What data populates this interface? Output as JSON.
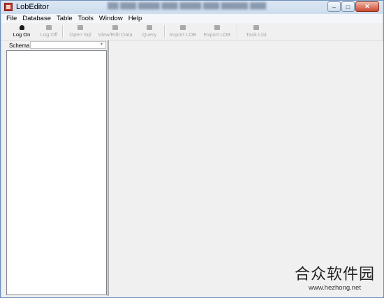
{
  "window": {
    "title": "LobEditor",
    "blurred_title_text": "(blurred text)"
  },
  "window_buttons": {
    "minimize": "–",
    "maximize": "□",
    "close": "✕"
  },
  "menu": [
    "File",
    "Database",
    "Table",
    "Tools",
    "Window",
    "Help"
  ],
  "toolbar": {
    "buttons": [
      {
        "label": "Log On",
        "enabled": true,
        "icon": "user-key-icon"
      },
      {
        "label": "Log Off",
        "enabled": false,
        "icon": "user-exit-icon"
      },
      {
        "label": "Open Sql",
        "enabled": false,
        "icon": "folder-icon"
      },
      {
        "label": "View/Edit Data",
        "enabled": false,
        "icon": "edit-data-icon"
      },
      {
        "label": "Query",
        "enabled": false,
        "icon": "query-icon"
      },
      {
        "label": "Import LOB",
        "enabled": false,
        "icon": "import-icon"
      },
      {
        "label": "Export LOB",
        "enabled": false,
        "icon": "export-icon"
      },
      {
        "label": "Task List",
        "enabled": false,
        "icon": "task-list-icon"
      }
    ]
  },
  "schema": {
    "label": "Schema",
    "value": ""
  },
  "watermark": {
    "main": "合众软件园",
    "sub": "www.hezhong.net"
  },
  "colors": {
    "accent": "#6d8fb8",
    "disabled_text": "#a7a7a7"
  }
}
